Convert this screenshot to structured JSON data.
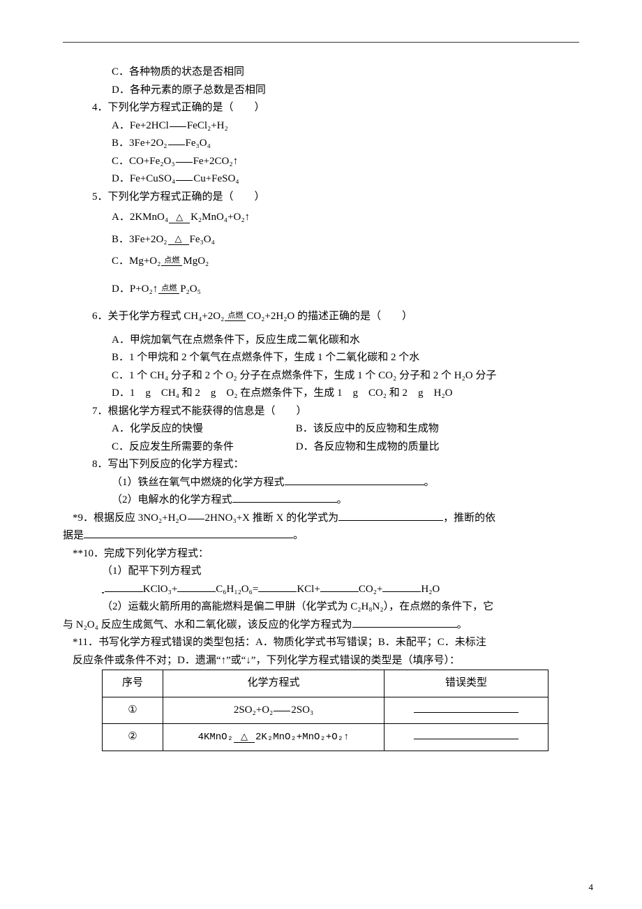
{
  "q3": {
    "optC": "C．各种物质的状态是否相同",
    "optD": "D．各种元素的原子总数是否相同"
  },
  "q4": {
    "stem": "4．下列化学方程式正确的是（　　）",
    "A_pre": "A．Fe+2HCl",
    "A_post": "FeCl₂+H₂",
    "B_pre": "B．3Fe+2O₂",
    "B_post": "Fe₃O₄",
    "C_pre": "C．CO+Fe₂O₃",
    "C_post": "Fe+2CO₂↑",
    "D_pre": "D．Fe+CuSO₄",
    "D_post": "Cu+FeSO₄"
  },
  "q5": {
    "stem": "5．下列化学方程式正确的是（　　）",
    "A_pre": "A．2KMnO₄",
    "A_post": "K₂MnO₄+O₂↑",
    "B_pre": "B．3Fe+2O₂",
    "B_post": "Fe₃O₄",
    "C_pre": "C．Mg+O₂",
    "C_cond": "点燃",
    "C_post": "MgO₂",
    "D_pre": "D．P+O₂↑",
    "D_cond": "点燃",
    "D_post": "P₂O₅"
  },
  "q6": {
    "stem_pre": "6．关于化学方程式 CH₄+2O₂",
    "stem_cond": "点燃",
    "stem_post": "CO₂+2H₂O 的描述正确的是（　　）",
    "A": "A．甲烷加氧气在点燃条件下，反应生成二氧化碳和水",
    "B": "B．1 个甲烷和 2 个氧气在点燃条件下，生成 1 个二氧化碳和 2 个水",
    "C": "C．1 个 CH₄ 分子和 2 个 O₂ 分子在点燃条件下，生成 1 个 CO₂ 分子和 2 个 H₂O 分子",
    "D": "D．1　g　CH₄ 和 2　g　O₂ 在点燃条件下，生成 1　g　CO₂ 和 2　g　H₂O"
  },
  "q7": {
    "stem": "7．根据化学方程式不能获得的信息是（　　）",
    "A": "A．化学反应的快慢",
    "B": "B．该反应中的反应物和生成物",
    "C": "C．反应发生所需要的条件",
    "D": "D．各反应物和生成物的质量比"
  },
  "q8": {
    "stem": "8．写出下列反应的化学方程式：",
    "p1": "（1）铁丝在氧气中燃烧的化学方程式",
    "p1_end": "。",
    "p2": "（2）电解水的化学方程式",
    "p2_end": "。"
  },
  "q9": {
    "pre": "*9．根据反应 3NO₂+H₂O",
    "post": "2HNO₃+X 推断 X 的化学式为",
    "mid": "，推断的依",
    "line2_pre": "据是",
    "line2_end": "。"
  },
  "q10": {
    "stem": "**10．完成下列化学方程式：",
    "p1": "（1）配平下列方程式",
    "eq_a": "KClO₃+",
    "eq_b": "C₆H₁₂O₆=",
    "eq_c": "KCl+",
    "eq_d": "CO₂+",
    "eq_e": "H₂O",
    "p2a": "（2）运载火箭所用的高能燃料是偏二甲肼（化学式为 C₂H₈N₂），在点燃的条件下，它",
    "p2b": "与 N₂O₄ 反应生成氮气、水和二氧化碳，该反应的化学方程式为",
    "p2b_end": "。"
  },
  "q11": {
    "l1": "*11．书写化学方程式错误的类型包括：A．物质化学式书写错误；B．未配平；C．未标注",
    "l2": "反应条件或条件不对；D．遗漏“↑”或“↓”，下列化学方程式错误的类型是（填序号）：",
    "th1": "序号",
    "th2": "化学方程式",
    "th3": "错误类型",
    "r1n": "①",
    "r1eq_pre": "2SO₂+O₂",
    "r1eq_post": "2SO₃",
    "r2n": "②",
    "r2eq_pre": "4KMnO₂",
    "r2eq_post": "2K₂MnO₂+MnO₂+O₂↑"
  },
  "pagenum": "4"
}
